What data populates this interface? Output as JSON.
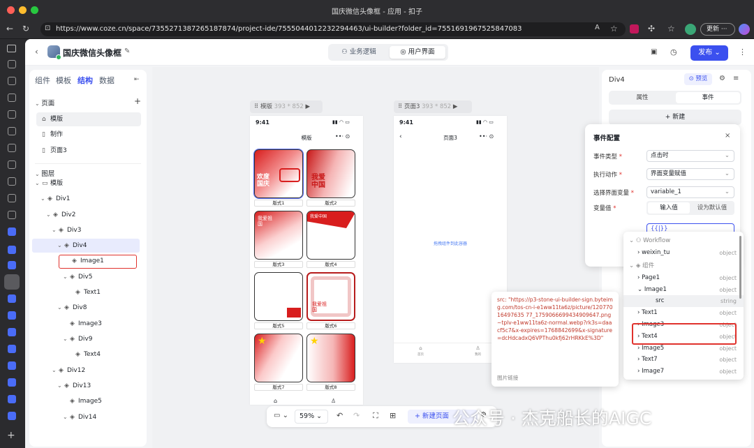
{
  "window": {
    "title": "国庆微信头像框 - 应用 - 扣子"
  },
  "browser": {
    "url": "https://www.coze.cn/space/7355271387265187874/project-ide/7555044012232294463/ui-builder?folder_id=7551691967525847083",
    "update_label": "更新"
  },
  "app": {
    "project_title": "国庆微信头像框",
    "tabs": [
      "业务逻辑",
      "用户界面"
    ],
    "publish_label": "发布"
  },
  "left": {
    "tabs": [
      "组件",
      "模板",
      "结构",
      "数据"
    ],
    "pages_header": "页面",
    "pages": [
      "模版",
      "制作",
      "页面3"
    ],
    "layers_header": "图层",
    "tree": [
      {
        "label": "模版",
        "depth": 0,
        "arrow": true,
        "icon": "frame"
      },
      {
        "label": "Div1",
        "depth": 1,
        "arrow": true,
        "icon": "layer"
      },
      {
        "label": "Div2",
        "depth": 2,
        "arrow": true,
        "icon": "layer"
      },
      {
        "label": "Div3",
        "depth": 3,
        "arrow": true,
        "icon": "layer"
      },
      {
        "label": "Div4",
        "depth": 4,
        "arrow": true,
        "icon": "layer"
      },
      {
        "label": "Image1",
        "depth": 5,
        "arrow": false,
        "icon": "layer"
      },
      {
        "label": "Div5",
        "depth": 5,
        "arrow": true,
        "icon": "layer"
      },
      {
        "label": "Text1",
        "depth": 6,
        "arrow": false,
        "icon": "layer"
      },
      {
        "label": "Div8",
        "depth": 4,
        "arrow": true,
        "icon": "layer"
      },
      {
        "label": "Image3",
        "depth": 5,
        "arrow": false,
        "icon": "layer"
      },
      {
        "label": "Div9",
        "depth": 5,
        "arrow": true,
        "icon": "layer"
      },
      {
        "label": "Text4",
        "depth": 6,
        "arrow": false,
        "icon": "layer"
      },
      {
        "label": "Div12",
        "depth": 3,
        "arrow": true,
        "icon": "layer"
      },
      {
        "label": "Div13",
        "depth": 4,
        "arrow": true,
        "icon": "layer"
      },
      {
        "label": "Image5",
        "depth": 5,
        "arrow": false,
        "icon": "layer"
      },
      {
        "label": "Div14",
        "depth": 5,
        "arrow": true,
        "icon": "layer"
      }
    ]
  },
  "canvas": {
    "phone1": {
      "label": "模版",
      "size": "393 * 852",
      "time": "9:41",
      "title": "模版",
      "cards": [
        "版式1",
        "版式2",
        "版式3",
        "版式4",
        "版式5",
        "版式6",
        "版式7",
        "版式8"
      ],
      "card_texts": {
        "c1": "欢度国庆",
        "c2": "我爱中国",
        "c3": "我爱祖国",
        "c4": "我爱中国",
        "c6": "我爱祖国"
      }
    },
    "phone2": {
      "label": "页面3",
      "size": "393 * 852",
      "time": "9:41",
      "title": "页面3",
      "placeholder": "拖拽组件到此容器",
      "nav": [
        "首页",
        "我的"
      ]
    }
  },
  "bottombar": {
    "zoom": "59%",
    "new_page": "新建页面"
  },
  "right": {
    "component": "Div4",
    "preview": "预览",
    "tabs": [
      "属性",
      "事件"
    ],
    "new_label": "+ 新建"
  },
  "event": {
    "title": "事件配置",
    "fields": [
      {
        "label": "事件类型",
        "value": "点击时"
      },
      {
        "label": "执行动作",
        "value": "界面变量赋值"
      },
      {
        "label": "选择界面变量",
        "value": "variable_1"
      }
    ],
    "var_label": "变量值",
    "var_tabs": [
      "输入值",
      "设为默认值"
    ],
    "var_input": "{{|}}"
  },
  "vardrop": {
    "sections": [
      {
        "name": "Workflow",
        "items": [
          {
            "label": "weixin_tu",
            "type": "object",
            "depth": 1
          }
        ]
      },
      {
        "name": "组件",
        "items": [
          {
            "label": "Page1",
            "type": "object",
            "depth": 1
          },
          {
            "label": "Image1",
            "type": "object",
            "depth": 1,
            "expanded": true
          },
          {
            "label": "src",
            "type": "string",
            "depth": 2,
            "selected": true
          },
          {
            "label": "Text1",
            "type": "object",
            "depth": 1
          },
          {
            "label": "Image3",
            "type": "object",
            "depth": 1
          },
          {
            "label": "Text4",
            "type": "object",
            "depth": 1
          },
          {
            "label": "Image5",
            "type": "object",
            "depth": 1
          },
          {
            "label": "Text7",
            "type": "object",
            "depth": 1
          },
          {
            "label": "Image7",
            "type": "object",
            "depth": 1
          }
        ]
      }
    ]
  },
  "tooltip": {
    "text": "src: \"https://p3-stone-ui-builder-sign.byteimg.com/tos-cn-i-e1ww11ta6z/picture/12077016497635 77_1759066699434909647.png~tplv-e1ww11ta6z-normal.webp?rk3s=daacf5c7&x-expires=1768842699&x-signature=dcHdcadxQ6VPThu0kfj62rHRKkE%3D\"",
    "caption": "图片链接"
  },
  "watermark": "公众号 · 杰克船长的AIGC",
  "colors": {
    "accent": "#3b50ef",
    "highlight_red": "#e0312c",
    "flag_red": "#d81e1e"
  }
}
